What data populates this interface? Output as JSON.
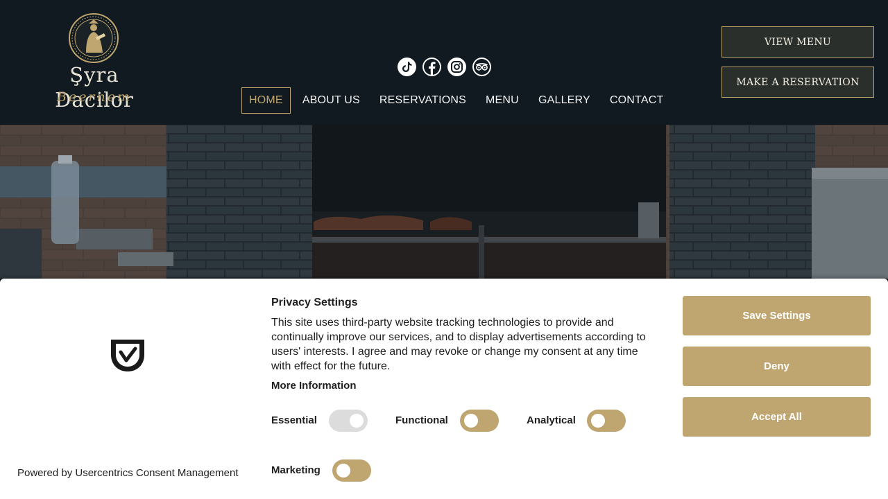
{
  "brand": {
    "name": "Şyra Dacilor",
    "location": "Beernem"
  },
  "socials": [
    "tiktok-icon",
    "facebook-icon",
    "instagram-icon",
    "tripadvisor-icon"
  ],
  "nav": {
    "items": [
      {
        "label": "HOME",
        "active": true
      },
      {
        "label": "ABOUT US",
        "active": false
      },
      {
        "label": "RESERVATIONS",
        "active": false
      },
      {
        "label": "MENU",
        "active": false
      },
      {
        "label": "GALLERY",
        "active": false
      },
      {
        "label": "CONTACT",
        "active": false
      }
    ]
  },
  "header_buttons": {
    "view_menu": "VIEW MENU",
    "reservation": "MAKE A RESERVATION"
  },
  "consent": {
    "title": "Privacy Settings",
    "text": "This site uses third-party website tracking technologies to provide and continually improve our services, and to display advertisements according to users' interests. I agree and may revoke or change my consent at any time with effect for the future.",
    "more_info": "More Information",
    "powered_by": "Powered by Usercentrics Consent Management",
    "toggles": {
      "essential": {
        "label": "Essential",
        "on": true,
        "disabled": true
      },
      "functional": {
        "label": "Functional",
        "on": false
      },
      "analytical": {
        "label": "Analytical",
        "on": false
      },
      "marketing": {
        "label": "Marketing",
        "on": false
      }
    },
    "buttons": {
      "save": "Save Settings",
      "deny": "Deny",
      "accept": "Accept All"
    }
  },
  "colors": {
    "header_bg": "#101a20",
    "accent": "#bfa56f",
    "consent_bg": "#ffffff"
  }
}
